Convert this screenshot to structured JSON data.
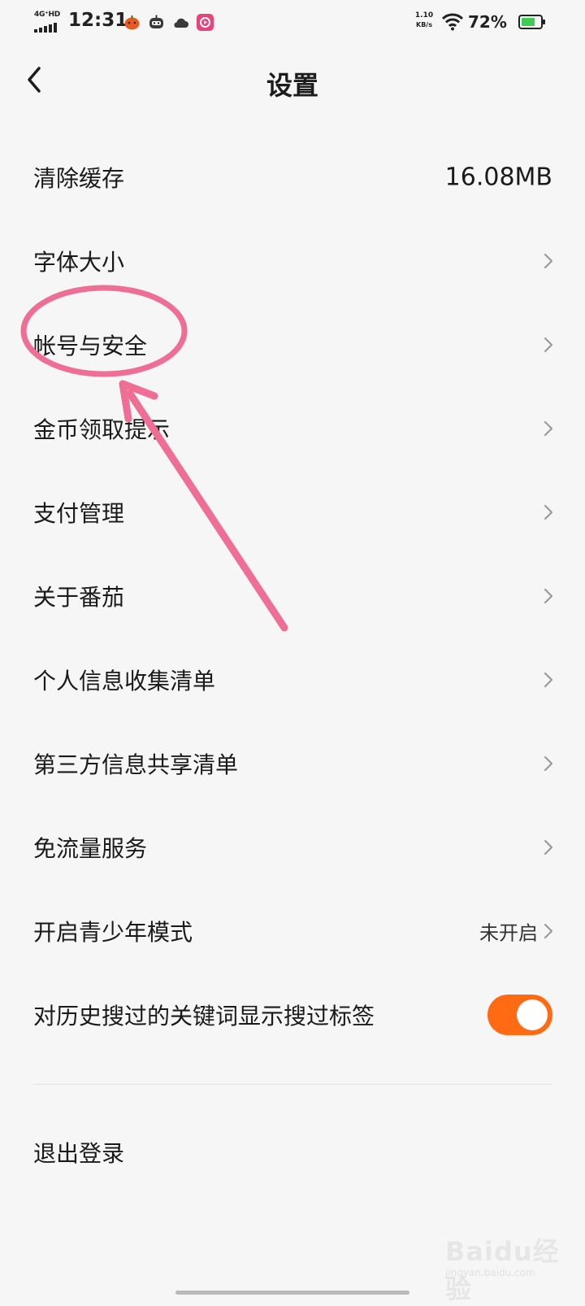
{
  "status_bar": {
    "network": "4G⁺HD",
    "time": "12:31",
    "net_speed_value": "1.10",
    "net_speed_unit": "KB/s",
    "battery_percent": "72%",
    "battery_level": 0.72,
    "battery_color": "#3fca54",
    "app_icons": [
      "pumpkin-app-icon",
      "robot-app-icon",
      "cloud-app-icon",
      "video-app-icon"
    ]
  },
  "header": {
    "title": "设置",
    "back_icon": "chevron-left-icon"
  },
  "settings": {
    "clear_cache": {
      "label": "清除缓存",
      "value": "16.08MB"
    },
    "font_size": {
      "label": "字体大小"
    },
    "account_security": {
      "label": "帐号与安全"
    },
    "coin_reminder": {
      "label": "金币领取提示"
    },
    "payment": {
      "label": "支付管理"
    },
    "about": {
      "label": "关于番茄"
    },
    "personal_info": {
      "label": "个人信息收集清单"
    },
    "third_party": {
      "label": "第三方信息共享清单"
    },
    "data_free": {
      "label": "免流量服务"
    },
    "youth_mode": {
      "label": "开启青少年模式",
      "status": "未开启"
    },
    "search_tag": {
      "label": "对历史搜过的关键词显示搜过标签",
      "enabled": true
    },
    "logout": {
      "label": "退出登录"
    }
  },
  "colors": {
    "accent": "#ff6a12",
    "annotation": "#ee6e95",
    "background": "#f6f6f6"
  },
  "watermark": {
    "brand": "Baidu经验",
    "url": "jingyan.baidu.com"
  }
}
